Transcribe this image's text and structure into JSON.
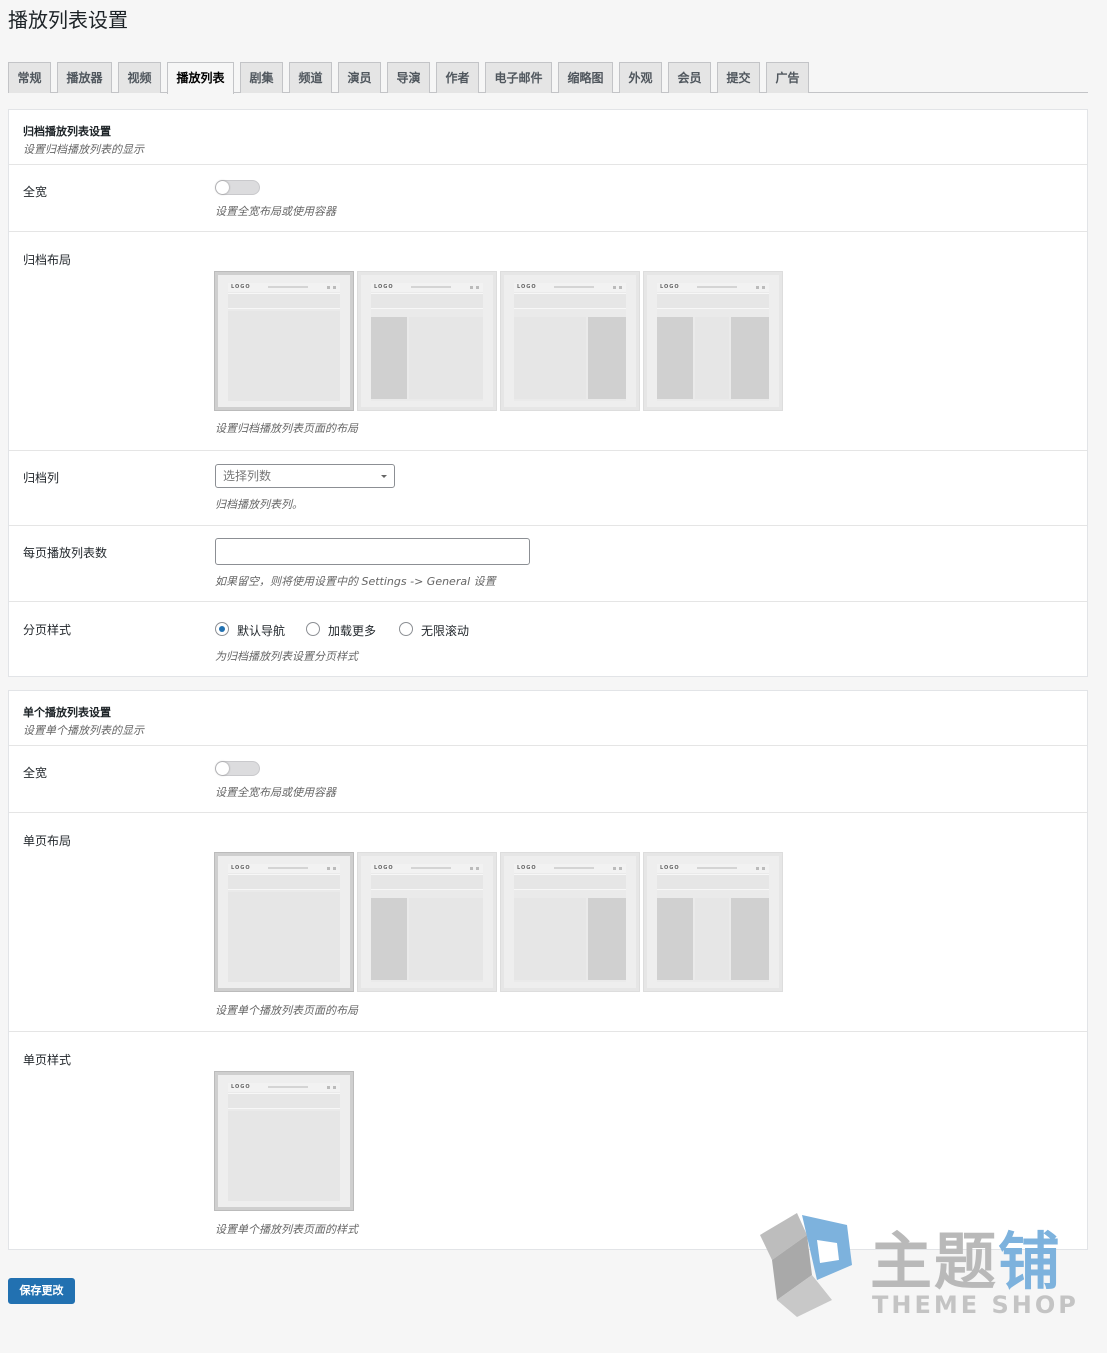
{
  "page": {
    "title": "播放列表设置"
  },
  "tabs": [
    {
      "label": "常规"
    },
    {
      "label": "播放器"
    },
    {
      "label": "视频"
    },
    {
      "label": "播放列表",
      "active": true
    },
    {
      "label": "剧集"
    },
    {
      "label": "频道"
    },
    {
      "label": "演员"
    },
    {
      "label": "导演"
    },
    {
      "label": "作者"
    },
    {
      "label": "电子邮件"
    },
    {
      "label": "缩略图"
    },
    {
      "label": "外观"
    },
    {
      "label": "会员"
    },
    {
      "label": "提交"
    },
    {
      "label": "广告"
    }
  ],
  "archive": {
    "title": "归档播放列表设置",
    "desc": "设置归档播放列表的显示",
    "fullwidth": {
      "label": "全宽",
      "help": "设置全宽布局或使用容器",
      "enabled": false
    },
    "layout": {
      "label": "归档布局",
      "help": "设置归档播放列表页面的布局",
      "logo_text": "LOGO",
      "options": [
        "full",
        "left-sidebar",
        "right-sidebar",
        "both-sidebars"
      ],
      "selected": "full"
    },
    "columns": {
      "label": "归档列",
      "placeholder": "选择列数",
      "help": "归档播放列表列。"
    },
    "per_page": {
      "label": "每页播放列表数",
      "value": "",
      "help": "如果留空，则将使用设置中的 Settings -> General 设置"
    },
    "pagination": {
      "label": "分页样式",
      "help": "为归档播放列表设置分页样式",
      "options": [
        {
          "label": "默认导航",
          "checked": true
        },
        {
          "label": "加载更多",
          "checked": false
        },
        {
          "label": "无限滚动",
          "checked": false
        }
      ]
    }
  },
  "single": {
    "title": "单个播放列表设置",
    "desc": "设置单个播放列表的显示",
    "fullwidth": {
      "label": "全宽",
      "help": "设置全宽布局或使用容器",
      "enabled": false
    },
    "layout": {
      "label": "单页布局",
      "help": "设置单个播放列表页面的布局",
      "logo_text": "LOGO",
      "options": [
        "full",
        "left-sidebar",
        "right-sidebar",
        "both-sidebars"
      ],
      "selected": "full"
    },
    "style": {
      "label": "单页样式",
      "help": "设置单个播放列表页面的样式",
      "logo_text": "LOGO",
      "options": [
        "style-1"
      ],
      "selected": "style-1"
    }
  },
  "save_button": "保存更改",
  "watermark": {
    "cn_part1": "主题",
    "cn_part2": "铺",
    "en": "THEME SHOP"
  },
  "colors": {
    "primary": "#2271b1",
    "toggle_off": "#dcdcde",
    "background": "#f6f6f6"
  }
}
